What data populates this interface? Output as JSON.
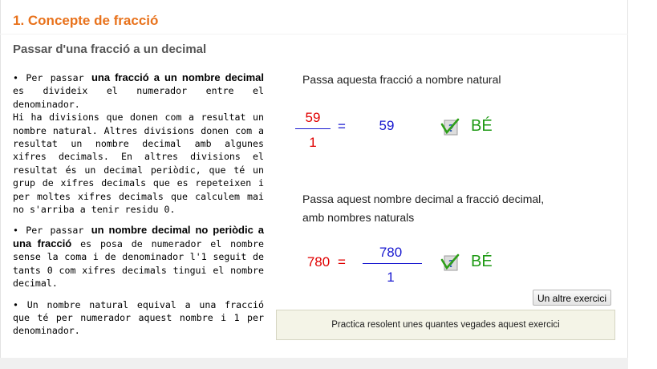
{
  "section_title": "1. Concepte de fracció",
  "subtitle": "Passar d'una fracció a un decimal",
  "explanation": {
    "p1_lead": "• Per passar ",
    "p1_bold": "una fracció a un nombre decimal",
    "p1_rest": " es divideix el numerador entre el denominador.",
    "p1_more": "Hi ha divisions que donen com a resultat un nombre natural. Altres divisions donen com a resultat un nombre decimal amb algunes xifres decimals. En altres divisions el resultat és un decimal periòdic, que té un grup de xifres decimals que es repeteixen i per moltes xifres decimals que calculem mai no s'arriba a tenir residu 0.",
    "p2_lead": "• Per passar ",
    "p2_bold": "un nombre decimal no periòdic a una fracció",
    "p2_rest": " es posa de numerador el nombre sense la coma i de denominador l'1 seguit de tants 0 com xifres decimals tingui el nombre decimal.",
    "p3": "• Un nombre natural equival a una fracció que té per numerador aquest nombre i 1 per denominador."
  },
  "exercise1": {
    "prompt": "Passa aquesta fracció a nombre natural",
    "numerator": "59",
    "denominator": "1",
    "equals": "=",
    "answer": "59",
    "icon": "check-icon",
    "feedback": "BÉ"
  },
  "exercise2": {
    "prompt_line1": "Passa aquest nombre decimal a fracció decimal,",
    "prompt_line2": "amb nombres naturals",
    "value": "780",
    "equals": "=",
    "numerator": "780",
    "denominator": "1",
    "icon": "check-icon",
    "feedback": "BÉ"
  },
  "another_button": "Un altre exercici",
  "practice_note": "Practica resolent unes quantes vegades aquest exercici",
  "colors": {
    "title": "#e8721c",
    "fraction_red": "#e00000",
    "input_blue": "#1a1ad0",
    "feedback_green": "#1e9a14"
  }
}
